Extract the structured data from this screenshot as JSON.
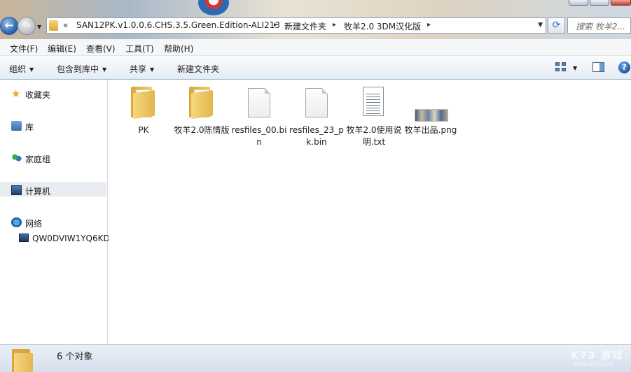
{
  "address": {
    "chevron": "«",
    "crumbs": [
      "SAN12PK.v1.0.0.6.CHS.3.5.Green.Edition-ALI213",
      "新建文件夹",
      "牧羊2.0 3DM汉化版"
    ]
  },
  "search": {
    "placeholder": "搜索 牧羊2..."
  },
  "menu": [
    "文件(F)",
    "编辑(E)",
    "查看(V)",
    "工具(T)",
    "帮助(H)"
  ],
  "commands": {
    "organize": "组织",
    "include_library": "包含到库中",
    "share": "共享",
    "new_folder": "新建文件夹"
  },
  "help_symbol": "?",
  "nav": {
    "favorites": "收藏夹",
    "libraries": "库",
    "homegroup": "家庭组",
    "computer": "计算机",
    "network": "网络",
    "network_pc": "QW0DVIW1YQ6KD"
  },
  "files": [
    {
      "name": "PK",
      "type": "folder"
    },
    {
      "name": "牧羊2.0陈情版",
      "type": "folder"
    },
    {
      "name": "resfiles_00.bin",
      "type": "file"
    },
    {
      "name": "resfiles_23_pk.bin",
      "type": "file"
    },
    {
      "name": "牧羊2.0使用说明.txt",
      "type": "txt"
    },
    {
      "name": "牧羊出品.png",
      "type": "png"
    }
  ],
  "status": {
    "count_text": "6 个对象"
  },
  "watermark": {
    "main": "K73 游戏",
    "sub": "www.k73.com"
  }
}
